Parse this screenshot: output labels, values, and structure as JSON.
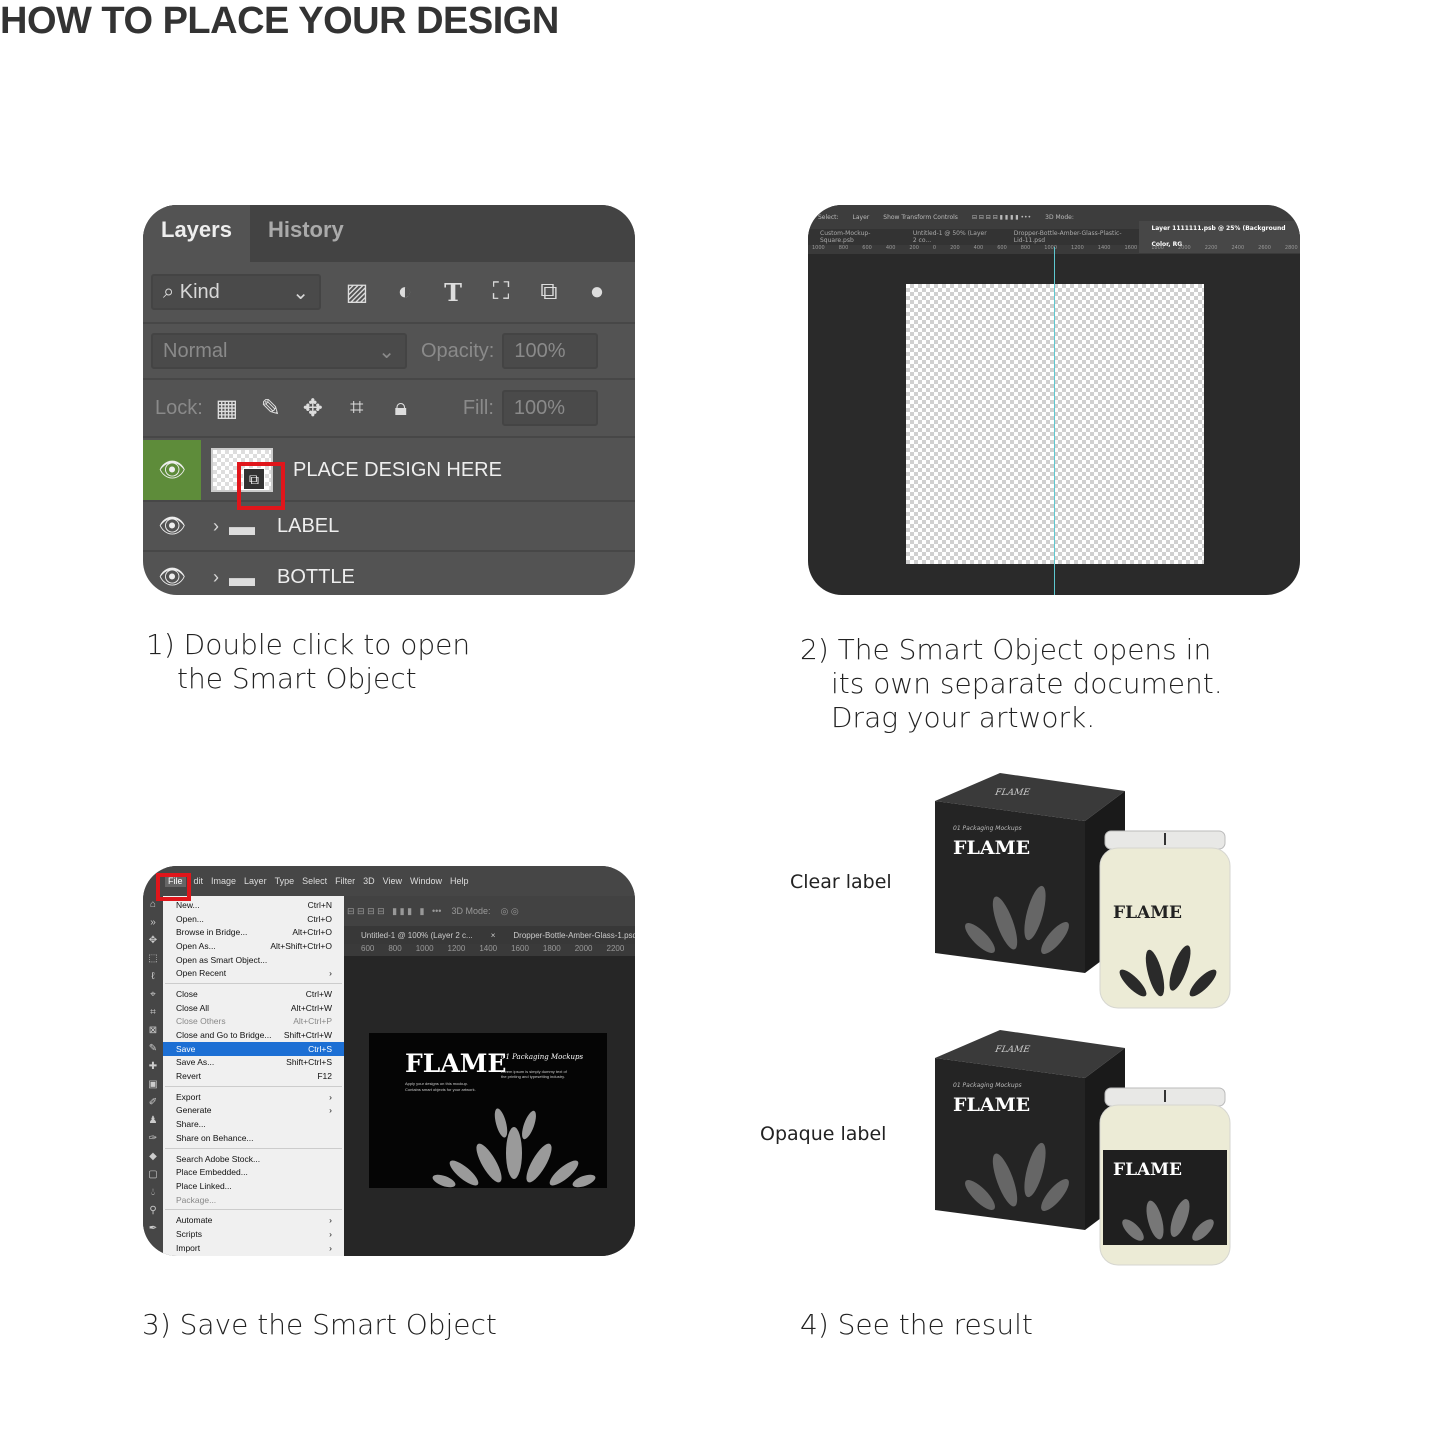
{
  "title": "HOW TO PLACE YOUR DESIGN",
  "steps": {
    "s1": {
      "line1": "1) Double click to open",
      "line2": "the Smart Object"
    },
    "s2": {
      "line1": "2) The Smart Object opens in",
      "line2": "its own separate document.",
      "line3": "Drag your artwork."
    },
    "s3": {
      "line1": "3) Save the Smart Object"
    },
    "s4": {
      "line1": "4) See the result"
    }
  },
  "layers_panel": {
    "tabs": [
      "Layers",
      "History"
    ],
    "filter": "Kind",
    "blend_mode": "Normal",
    "opacity_label": "Opacity:",
    "opacity": "100%",
    "lock_label": "Lock:",
    "fill_label": "Fill:",
    "fill": "100%",
    "layers": [
      {
        "name": "PLACE DESIGN HERE",
        "type": "smart-object",
        "highlight_color": "#5e8c3a"
      },
      {
        "name": "LABEL",
        "type": "group"
      },
      {
        "name": "BOTTLE",
        "type": "group"
      }
    ],
    "highlight_box_color": "#e0161b"
  },
  "smart_doc": {
    "options": [
      "Select:",
      "Layer",
      "Show Transform Controls",
      "3D Mode:"
    ],
    "tabs": [
      "Custom-Mockup-Square.psb",
      "Untitled-1 @ 50% (Layer 2 co...",
      "Dropper-Bottle-Amber-Glass-Plastic-Lid-11.psd",
      "Layer 1111111.psb @ 25% (Background Color, RG"
    ],
    "ruler": [
      "1000",
      "800",
      "600",
      "400",
      "200",
      "0",
      "200",
      "400",
      "600",
      "800",
      "1000",
      "1200",
      "1400",
      "1600",
      "1800",
      "2000",
      "2200",
      "2400",
      "2600",
      "2800",
      "3000",
      "3200",
      "3400",
      "3600",
      "3800"
    ]
  },
  "file_menu": {
    "menubar": [
      "File",
      "dit",
      "Image",
      "Layer",
      "Type",
      "Select",
      "Filter",
      "3D",
      "View",
      "Window",
      "Help"
    ],
    "options_right": "3D Mode:",
    "doc_tabs": [
      "Untitled-1 @ 100% (Layer 2 c...",
      "Dropper-Bottle-Amber-Glass-1.psd"
    ],
    "ruler": [
      "600",
      "800",
      "1000",
      "1200",
      "1400",
      "1600",
      "1800",
      "2000",
      "2200",
      "2400"
    ],
    "items": [
      {
        "label": "New...",
        "key": "Ctrl+N"
      },
      {
        "label": "Open...",
        "key": "Ctrl+O"
      },
      {
        "label": "Browse in Bridge...",
        "key": "Alt+Ctrl+O"
      },
      {
        "label": "Open As...",
        "key": "Alt+Shift+Ctrl+O"
      },
      {
        "label": "Open as Smart Object...",
        "key": ""
      },
      {
        "label": "Open Recent",
        "key": "›"
      },
      {
        "sep": true
      },
      {
        "label": "Close",
        "key": "Ctrl+W"
      },
      {
        "label": "Close All",
        "key": "Alt+Ctrl+W"
      },
      {
        "label": "Close Others",
        "key": "Alt+Ctrl+P",
        "disabled": true
      },
      {
        "label": "Close and Go to Bridge...",
        "key": "Shift+Ctrl+W"
      },
      {
        "label": "Save",
        "key": "Ctrl+S",
        "selected": true
      },
      {
        "label": "Save As...",
        "key": "Shift+Ctrl+S"
      },
      {
        "label": "Revert",
        "key": "F12"
      },
      {
        "sep": true
      },
      {
        "label": "Export",
        "key": "›"
      },
      {
        "label": "Generate",
        "key": "›"
      },
      {
        "label": "Share...",
        "key": ""
      },
      {
        "label": "Share on Behance...",
        "key": ""
      },
      {
        "sep": true
      },
      {
        "label": "Search Adobe Stock...",
        "key": ""
      },
      {
        "label": "Place Embedded...",
        "key": ""
      },
      {
        "label": "Place Linked...",
        "key": ""
      },
      {
        "label": "Package...",
        "key": "",
        "disabled": true
      },
      {
        "sep": true
      },
      {
        "label": "Automate",
        "key": "›"
      },
      {
        "label": "Scripts",
        "key": "›"
      },
      {
        "label": "Import",
        "key": "›"
      }
    ],
    "selected_color": "#1c6fd4",
    "artwork": {
      "brand": "FLAME",
      "script": "01 Packaging Mockups",
      "tagline1": "Apply your designs on this mockup.",
      "tagline2": "Contains smart objects for your artwork.",
      "body": "Lorem ipsum is simply dummy text of the printing and typesetting industry."
    }
  },
  "results": {
    "clear_label": "Clear label",
    "opaque_label": "Opaque label",
    "brand": "FLAME",
    "box_top": "FLAME",
    "script": "01 Packaging Mockups"
  }
}
